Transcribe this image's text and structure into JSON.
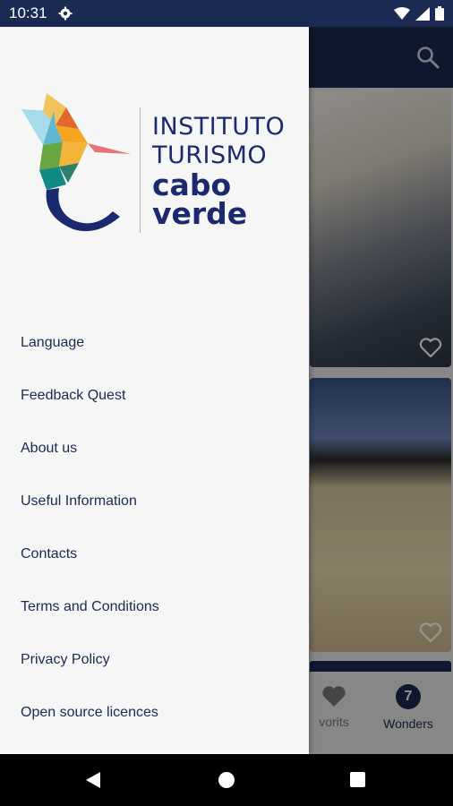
{
  "status_bar": {
    "time": "10:31",
    "icons": [
      "settings-icon",
      "wifi-icon",
      "signal-icon",
      "battery-icon"
    ]
  },
  "app_bar": {
    "icons": [
      "search-icon"
    ]
  },
  "bottom_nav": {
    "favorites_label": "vorits",
    "wonders_label": "Wonders",
    "wonders_badge": "7"
  },
  "drawer": {
    "logo": {
      "line1": "INSTITUTO",
      "line2": "TURISMO",
      "line3": "cabo",
      "line4": "verde"
    },
    "menu_items": [
      "Language",
      "Feedback Quest",
      "About us",
      "Useful Information",
      "Contacts",
      "Terms and Conditions",
      "Privacy Policy",
      "Open source licences"
    ]
  },
  "colors": {
    "primary": "#1b2a52",
    "drawer_bg": "#f6f6f6",
    "logo_text": "#1b2a6e"
  }
}
